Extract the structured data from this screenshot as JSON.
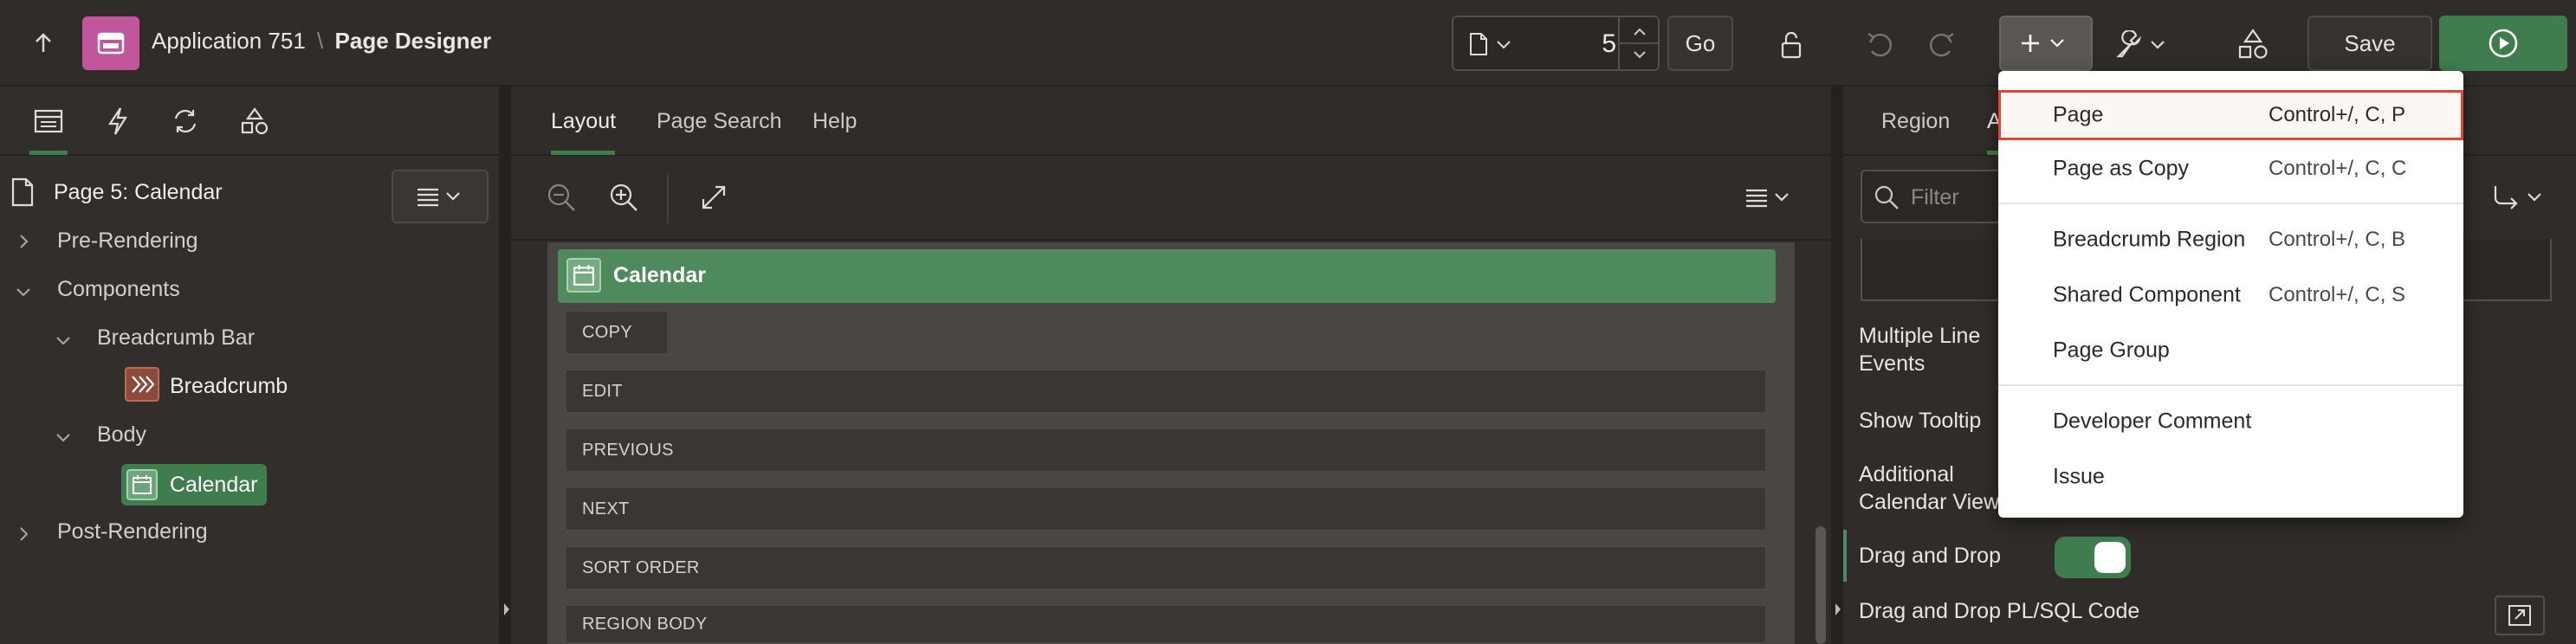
{
  "header": {
    "app_name": "Application 751",
    "separator": "\\",
    "page_title": "Page Designer",
    "page_number": "5",
    "go_label": "Go",
    "save_label": "Save"
  },
  "left_panel": {
    "page_label": "Page 5: Calendar",
    "tree": {
      "pre_rendering": "Pre-Rendering",
      "components": "Components",
      "breadcrumb_bar": "Breadcrumb Bar",
      "breadcrumb": "Breadcrumb",
      "body": "Body",
      "calendar": "Calendar",
      "post_rendering": "Post-Rendering"
    }
  },
  "center": {
    "tabs": [
      "Layout",
      "Page Search",
      "Help"
    ],
    "active_tab": "Layout",
    "region_title": "Calendar",
    "positions": [
      "COPY",
      "EDIT",
      "PREVIOUS",
      "NEXT",
      "SORT ORDER",
      "REGION BODY"
    ]
  },
  "right_panel": {
    "tab_region": "Region",
    "tab_attributes_partial": "A",
    "filter_placeholder": "Filter",
    "labels": {
      "multiple_line_1": "Multiple Line",
      "multiple_line_2": "Events",
      "show_tooltip": "Show Tooltip",
      "additional_1": "Additional",
      "additional_2": "Calendar Views",
      "drag_drop": "Drag and Drop",
      "drag_drop_code": "Drag and Drop PL/SQL Code"
    },
    "drag_drop_enabled": true
  },
  "create_menu": {
    "items": [
      {
        "label": "Page",
        "shortcut": "Control+/, C, P"
      },
      {
        "label": "Page as Copy",
        "shortcut": "Control+/, C, C"
      },
      {
        "label": "Breadcrumb Region",
        "shortcut": "Control+/, C, B"
      },
      {
        "label": "Shared Component",
        "shortcut": "Control+/, C, S"
      },
      {
        "label": "Page Group",
        "shortcut": ""
      },
      {
        "label": "Developer Comment",
        "shortcut": ""
      },
      {
        "label": "Issue",
        "shortcut": ""
      }
    ]
  },
  "colors": {
    "accent_green": "#3f7d4f",
    "highlight_red": "#e0453a",
    "app_icon_pink": "#c2569c"
  }
}
